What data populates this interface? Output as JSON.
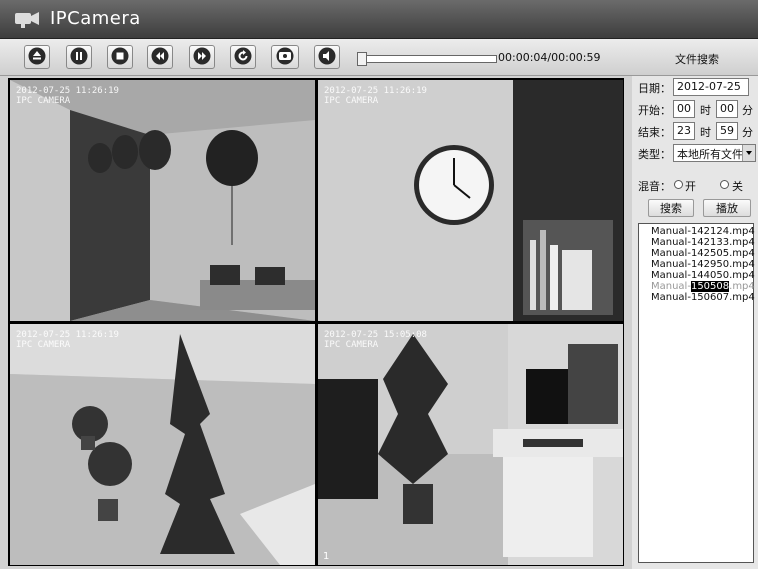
{
  "app": {
    "title": "IPCamera"
  },
  "toolbar": {
    "buttons": [
      {
        "name": "eject-button",
        "icon": "eject-icon"
      },
      {
        "name": "pause-button",
        "icon": "pause-icon"
      },
      {
        "name": "stop-button",
        "icon": "stop-icon"
      },
      {
        "name": "rewind-button",
        "icon": "rewind-icon"
      },
      {
        "name": "fast-forward-button",
        "icon": "fast-forward-icon"
      },
      {
        "name": "refresh-button",
        "icon": "refresh-icon"
      },
      {
        "name": "record-button",
        "icon": "record-icon"
      },
      {
        "name": "mute-button",
        "icon": "speaker-icon"
      }
    ],
    "progress": 0.0,
    "timecode": "00:00:04/00:00:59",
    "search_title": "文件搜索"
  },
  "cameras": [
    {
      "osd_line1": "2012-07-25 11:26:19",
      "osd_line2": "IPC CAMERA",
      "channel": ""
    },
    {
      "osd_line1": "2012-07-25 11:26:19",
      "osd_line2": "IPC CAMERA",
      "channel": ""
    },
    {
      "osd_line1": "2012-07-25 11:26:19",
      "osd_line2": "IPC CAMERA",
      "channel": ""
    },
    {
      "osd_line1": "2012-07-25 15:05:08",
      "osd_line2": "IPC CAMERA",
      "channel": "1"
    }
  ],
  "search": {
    "date_label": "日期：",
    "date_value": "2012-07-25",
    "start_label": "开始：",
    "start_hour": "00",
    "start_min": "00",
    "end_label": "结束：",
    "end_hour": "23",
    "end_min": "59",
    "hour_unit": "时",
    "min_unit": "分",
    "type_label": "类型：",
    "type_value": "本地所有文件",
    "mix_label": "混音：",
    "mix_on": "开",
    "mix_off": "关",
    "search_button": "搜索",
    "play_button": "播放"
  },
  "files": [
    "Manual-142124.mp4",
    "Manual-142133.mp4",
    "Manual-142505.mp4",
    "Manual-142950.mp4",
    "Manual-144050.mp4",
    "Manual-150508.mp4",
    "Manual-150607.mp4"
  ],
  "selected_file": {
    "prefix": "Manual-",
    "highlight": "150508",
    "suffix": ".mp4"
  }
}
